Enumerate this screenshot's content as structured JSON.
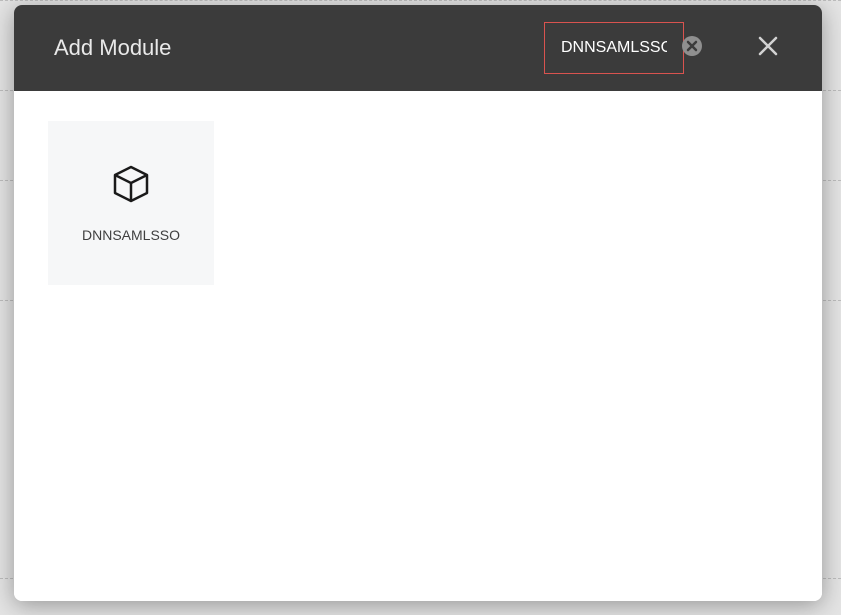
{
  "header": {
    "title": "Add Module",
    "search_value": "DNNSAMLSSO"
  },
  "modules": [
    {
      "icon": "cube-icon",
      "label": "DNNSAMLSSO"
    }
  ]
}
